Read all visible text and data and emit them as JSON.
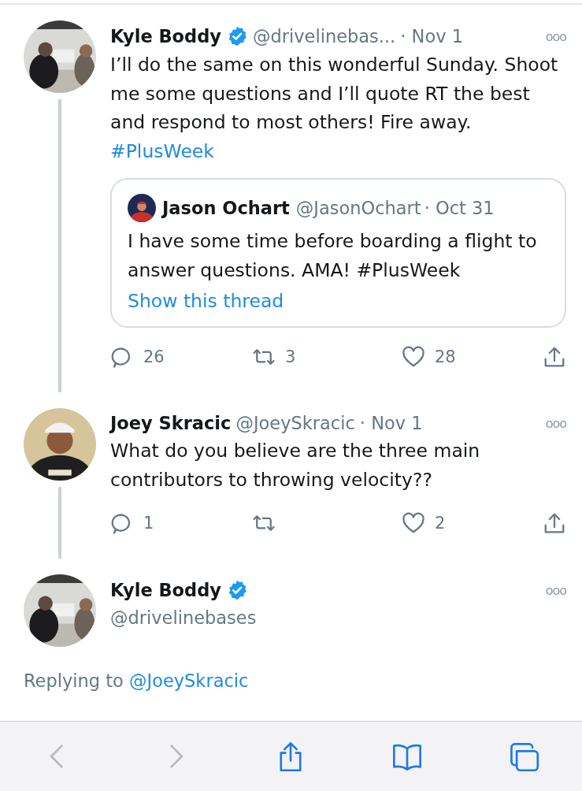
{
  "tweets": [
    {
      "kind": "inline",
      "name": "Kyle Boddy",
      "verified": true,
      "handle": "@drivelinebas...",
      "date": "· Nov 1",
      "more": "ooo",
      "thread_below": true,
      "text": "I’ll do the same on this wonderful Sunday. Shoot me some questions and I’ll quote RT the best and respond to most others! Fire away.",
      "hashtag": "#PlusWeek",
      "quote": {
        "name": "Jason Ochart",
        "handle": "@JasonOchart",
        "date": "· Oct 31",
        "text": "I have some time before boarding a flight to answer questions. AMA! #PlusWeek",
        "link": "Show this thread"
      },
      "actions": {
        "replies": "26",
        "retweets": "3",
        "likes": "28"
      }
    },
    {
      "kind": "inline",
      "name": "Joey Skracic",
      "verified": false,
      "handle": "@JoeySkracic",
      "date": "· Nov 1",
      "more": "ooo",
      "thread_below": true,
      "text": "What do you believe are the three main contributors to throwing velocity??",
      "actions": {
        "replies": "1",
        "likes": "2"
      }
    },
    {
      "kind": "stacked",
      "name": "Kyle Boddy",
      "verified": true,
      "handle": "@drivelinebases",
      "more": "ooo",
      "thread_below": false,
      "replying_label": "Replying to",
      "replying_to": "@JoeySkracic"
    }
  ],
  "toolbar": [
    {
      "kind": "back",
      "disabled": true
    },
    {
      "kind": "forward",
      "disabled": true
    },
    {
      "kind": "share",
      "disabled": false
    },
    {
      "kind": "bookmarks",
      "disabled": false
    },
    {
      "kind": "tabs",
      "disabled": false
    }
  ]
}
